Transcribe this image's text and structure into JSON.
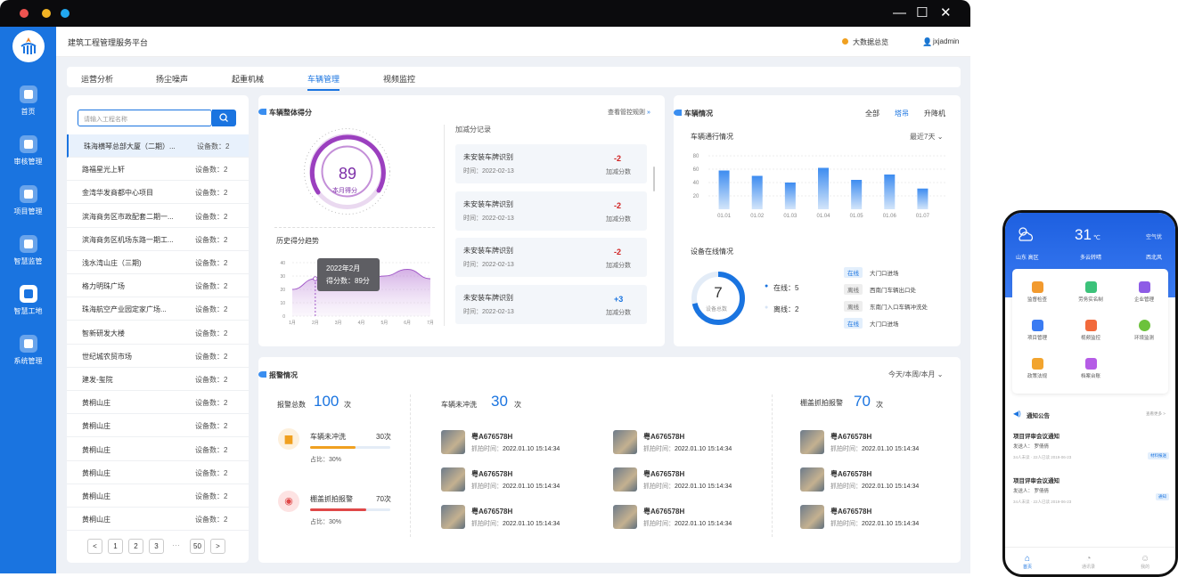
{
  "window": {
    "controls": [
      "—",
      "☐",
      "✕"
    ]
  },
  "header": {
    "title": "建筑工程管理服务平台",
    "big_data_link": "大数据总览",
    "user": "jxjadmin"
  },
  "sidebar": {
    "items": [
      {
        "label": "首页"
      },
      {
        "label": "审核管理"
      },
      {
        "label": "项目管理"
      },
      {
        "label": "智慧监管"
      },
      {
        "label": "智慧工地"
      },
      {
        "label": "系统管理"
      }
    ],
    "active_index": 4
  },
  "tabs": [
    {
      "label": "运营分析"
    },
    {
      "label": "扬尘噪声"
    },
    {
      "label": "起重机械"
    },
    {
      "label": "车辆管理"
    },
    {
      "label": "视频监控"
    }
  ],
  "project_list": {
    "search_placeholder": "请输入工程名称",
    "rows": [
      {
        "name": "珠海横琴总部大厦（二期）...",
        "count": "设备数：2"
      },
      {
        "name": "路福星光上轩",
        "count": "设备数：2"
      },
      {
        "name": "金湾华发商都中心项目",
        "count": "设备数：2"
      },
      {
        "name": "滨海商务区市政配套二期一...",
        "count": "设备数：2"
      },
      {
        "name": "滨海商务区机场东路一期工...",
        "count": "设备数：2"
      },
      {
        "name": "浅水湾山庄（三期)",
        "count": "设备数：2"
      },
      {
        "name": "格力明珠广场",
        "count": "设备数：2"
      },
      {
        "name": "珠海航空产业园定家广场...",
        "count": "设备数：2"
      },
      {
        "name": "智新研发大楼",
        "count": "设备数：2"
      },
      {
        "name": "世纪城农贸市场",
        "count": "设备数：2"
      },
      {
        "name": "建发-玺院",
        "count": "设备数：2"
      },
      {
        "name": "黄桐山庄",
        "count": "设备数：2"
      },
      {
        "name": "黄桐山庄",
        "count": "设备数：2"
      },
      {
        "name": "黄桐山庄",
        "count": "设备数：2"
      },
      {
        "name": "黄桐山庄",
        "count": "设备数：2"
      },
      {
        "name": "黄桐山庄",
        "count": "设备数：2"
      },
      {
        "name": "黄桐山庄",
        "count": "设备数：2"
      }
    ],
    "pagination": [
      "<",
      "1",
      "2",
      "3",
      "···",
      "50",
      ">"
    ]
  },
  "score_card": {
    "title": "车辆整体得分",
    "rule_link": "查看管控规则",
    "score": "89",
    "score_label": "本月得分",
    "records_title": "加减分记录",
    "records": [
      {
        "name": "未安装车牌识别",
        "time": "时间：2022-02-13",
        "value": "-2",
        "label": "加减分数"
      },
      {
        "name": "未安装车牌识别",
        "time": "时间：2022-02-13",
        "value": "-2",
        "label": "加减分数"
      },
      {
        "name": "未安装车牌识别",
        "time": "时间：2022-02-13",
        "value": "-2",
        "label": "加减分数"
      },
      {
        "name": "未安装车牌识别",
        "time": "时间：2022-02-13",
        "value": "+3",
        "label": "加减分数"
      }
    ],
    "trend_title": "历史得分趋势",
    "tooltip": {
      "line1": "2022年2月",
      "line2": "得分数：89分"
    }
  },
  "chart_data": [
    {
      "type": "area",
      "title": "历史得分趋势",
      "x": [
        "1月",
        "2月",
        "3月",
        "4月",
        "5月",
        "6月",
        "7月"
      ],
      "y_ticks": [
        "0",
        "10",
        "20",
        "30",
        "40"
      ],
      "values": [
        20,
        28,
        27,
        25,
        30,
        35,
        28
      ],
      "ylim": [
        0,
        40
      ]
    },
    {
      "type": "bar",
      "title": "车辆通行情况",
      "categories": [
        "01.01",
        "01.02",
        "01.03",
        "01.04",
        "01.05",
        "01.06",
        "01.07"
      ],
      "values": [
        58,
        50,
        40,
        62,
        44,
        52,
        31
      ],
      "y_ticks": [
        "20",
        "40",
        "60",
        "80"
      ],
      "ylim": [
        0,
        80
      ]
    }
  ],
  "vehicle_card": {
    "title": "车辆情况",
    "filters": [
      "全部",
      "塔吊",
      "升降机"
    ],
    "active_filter": 1,
    "traffic_title": "车辆通行情况",
    "range": "最近7天",
    "online_title": "设备在线情况",
    "total": "7",
    "total_label": "设备总数",
    "online": "在线：5",
    "offline": "离线：2",
    "devices": [
      {
        "status": "在线",
        "name": "大门口进场",
        "on": true
      },
      {
        "status": "离线",
        "name": "西南门车辆出口处",
        "on": false
      },
      {
        "status": "离线",
        "name": "东南门入口车辆冲洗处",
        "on": false
      },
      {
        "status": "在线",
        "name": "大门口进场",
        "on": true
      }
    ]
  },
  "alarm_card": {
    "title": "报警情况",
    "range": "今天/本周/本月",
    "total_label": "报警总数",
    "total": "100",
    "unit": "次",
    "items": [
      {
        "name": "车辆未冲洗",
        "count": "30次",
        "ratio": "占比：30%",
        "percent": 30,
        "color": "#f0a020"
      },
      {
        "name": "棚盖抓拍报警",
        "count": "70次",
        "ratio": "占比：30%",
        "percent": 70,
        "color": "#e04848"
      }
    ],
    "unwashed_label": "车辆未冲洗",
    "unwashed": "30",
    "cover_label": "棚盖抓拍报警",
    "cover": "70",
    "plate": "粤A676578H",
    "time_label": "抓拍时间：",
    "time": "2022.01.10 15:14:34"
  },
  "mobile": {
    "temp": "31",
    "temp_unit": "℃",
    "air": "空气优",
    "location": "山东  高区",
    "weather": "多云转晴",
    "wind": "西北风",
    "grid": [
      "监督检查",
      "劳务实名制",
      "企业管理",
      "项目管理",
      "视频监控",
      "环境监测",
      "政策法规",
      "档案台账"
    ],
    "notice_title": "通知公告",
    "notice_more": "查看更多 >",
    "notices": [
      {
        "title": "项目评审会议通知",
        "sender": "发送人：  罗倩倩",
        "meta": "34人未读 · 22人已读       2019-06-23",
        "tag": "材料报送"
      },
      {
        "title": "项目评审会议通知",
        "sender": "发送人：  罗倩倩",
        "meta": "34人未读 · 22人已读       2019-06-23",
        "tag": "通知"
      }
    ],
    "bottom_nav": [
      "首页",
      "通讯录",
      "我的"
    ]
  }
}
